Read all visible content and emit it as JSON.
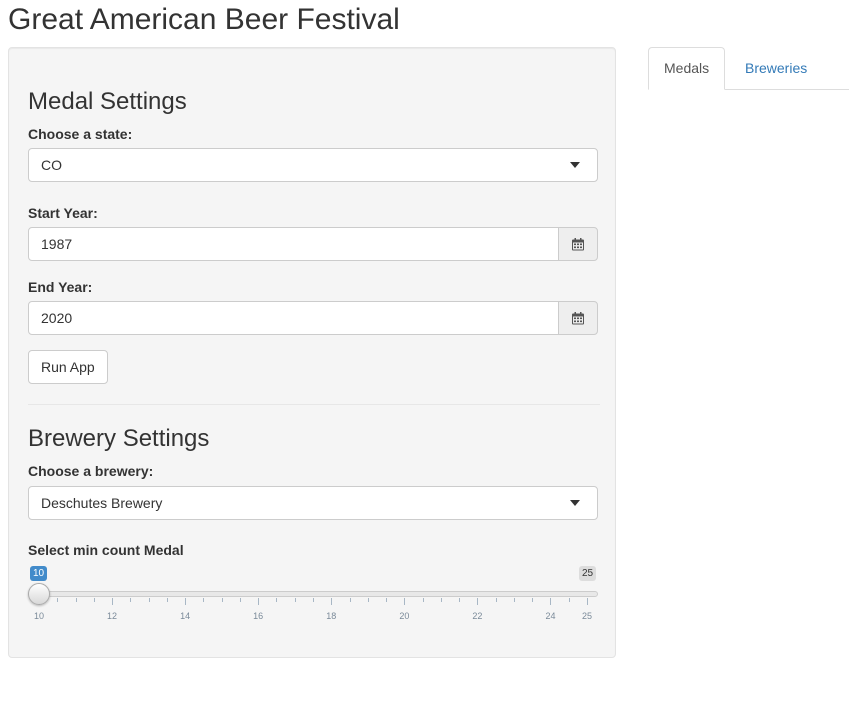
{
  "app": {
    "title": "Great American Beer Festival"
  },
  "medal_settings": {
    "heading": "Medal Settings",
    "state_label": "Choose a state:",
    "state_value": "CO",
    "start_year_label": "Start Year:",
    "start_year_value": "1987",
    "end_year_label": "End Year:",
    "end_year_value": "2020",
    "run_button_label": "Run App"
  },
  "brewery_settings": {
    "heading": "Brewery Settings",
    "brewery_label": "Choose a brewery:",
    "brewery_value": "Deschutes Brewery",
    "slider_label": "Select min count Medal",
    "slider": {
      "min": 10,
      "max": 25,
      "value": 10,
      "value_label": "10",
      "max_label": "25",
      "tick_labels": [
        "10",
        "12",
        "14",
        "16",
        "18",
        "20",
        "22",
        "24",
        "25"
      ]
    }
  },
  "tabs": [
    {
      "label": "Medals",
      "active": true
    },
    {
      "label": "Breweries",
      "active": false
    }
  ],
  "icons": {
    "calendar": "calendar-icon",
    "dropdown": "caret-down-icon"
  },
  "colors": {
    "accent": "#428bca",
    "link": "#337ab7",
    "panel": "#f5f5f5"
  }
}
